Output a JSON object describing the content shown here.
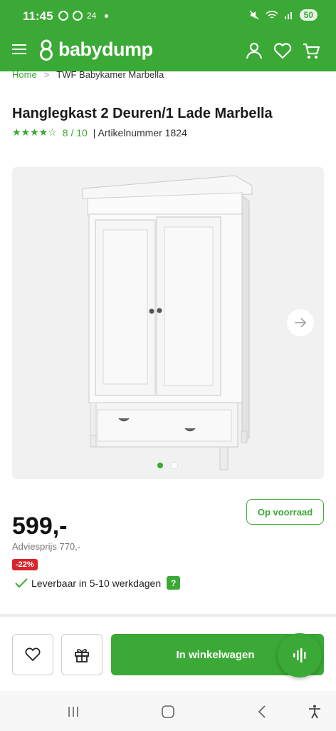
{
  "status_bar": {
    "time": "11:45",
    "notif_count": "24",
    "battery": "50"
  },
  "header": {
    "logo_text": "babydump",
    "icons": [
      "menu-icon",
      "account-icon",
      "heart-icon",
      "cart-icon"
    ]
  },
  "breadcrumb": {
    "home": "Home",
    "separator": ">",
    "current": "TWF Babykamer Marbella"
  },
  "product": {
    "title": "Hanglegkast 2 Deuren/1 Lade Marbella",
    "stars": "★★★★☆",
    "rating": "8 / 10",
    "article": "| Artikelnummer 1824",
    "price": "599,-",
    "advies": "Adviesprijs 770,-",
    "discount": "-22%",
    "stock": "Op voorraad",
    "delivery": "Leverbaar in 5-10 werkdagen",
    "help": "?"
  },
  "gallery": {
    "image_count": 2,
    "active_index": 0
  },
  "actions": {
    "add_to_cart": "In winkelwagen"
  },
  "colors": {
    "brand_green": "#3aa935",
    "discount_red": "#d7262b"
  }
}
